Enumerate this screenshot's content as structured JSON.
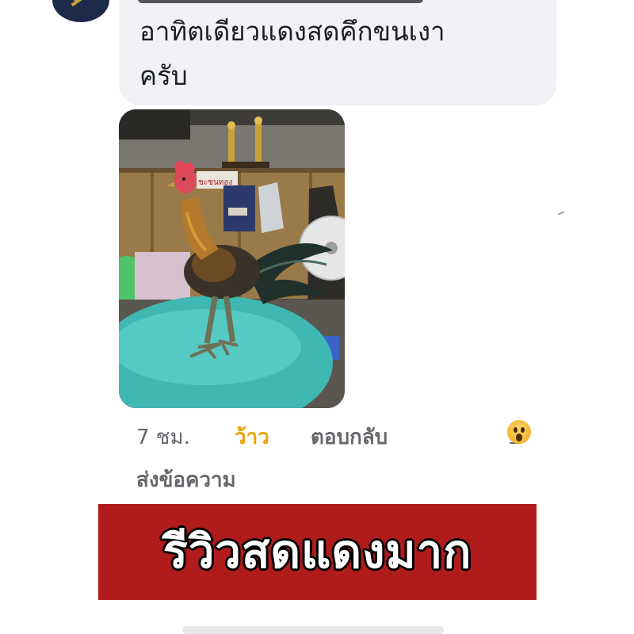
{
  "comment": {
    "line1": "อาทิตเดียวแดงสดคึกขนเงา",
    "line2": "ครับ"
  },
  "photo": {
    "subject": "rooster standing on a teal cushion",
    "sign_text": "ชะชนทอง"
  },
  "meta": {
    "time": "7 ชม.",
    "reaction_label": "ว้าว",
    "reply": "ตอบกลับ",
    "send_message": "ส่งข้อความ",
    "reaction_count": "1",
    "reaction_icon": "wow-emoji-icon"
  },
  "banner": {
    "text": "รีวิวสดแดงมาก",
    "background": "#b01c1c"
  },
  "colors": {
    "bubble": "#f0f2f5",
    "meta_text": "#65676b",
    "wow_accent": "#e8a400"
  }
}
